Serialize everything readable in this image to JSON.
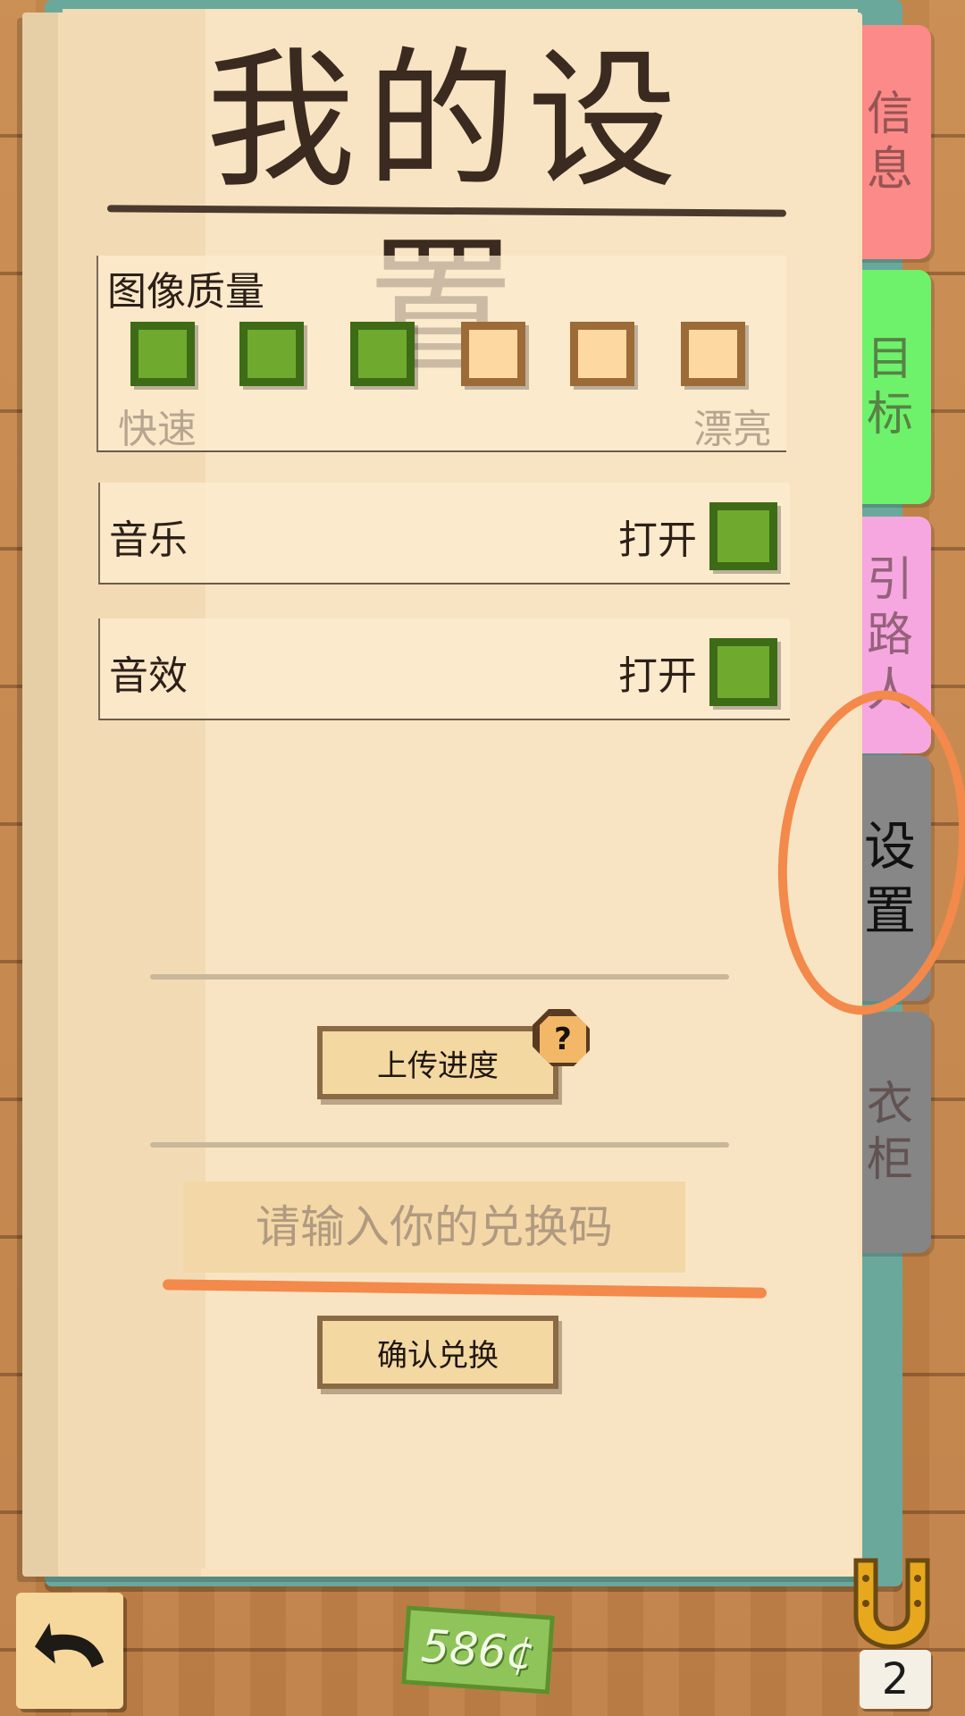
{
  "page": {
    "title": "我的设置"
  },
  "tabs": [
    {
      "label": [
        "信",
        "息"
      ]
    },
    {
      "label": [
        "目",
        "标"
      ]
    },
    {
      "label": [
        "引",
        "路",
        "人"
      ]
    },
    {
      "label": [
        "设",
        "置"
      ],
      "selected": true
    },
    {
      "label": [
        "衣",
        "柜"
      ]
    }
  ],
  "quality": {
    "label": "图像质量",
    "low_label": "快速",
    "high_label": "漂亮",
    "levels": 6,
    "selected_level": 3
  },
  "music": {
    "label": "音乐",
    "state_label": "打开"
  },
  "sfx": {
    "label": "音效",
    "state_label": "打开"
  },
  "upload": {
    "label": "上传进度",
    "help_glyph": "?"
  },
  "redeem": {
    "placeholder": "请输入你的兑换码",
    "button_label": "确认兑换"
  },
  "footer": {
    "money": "586¢",
    "horseshoe_count": "2"
  },
  "colors": {
    "accent_annotation": "#f3894a",
    "checkbox_on": "#6faa2e",
    "checkbox_off": "#fdd8a0"
  }
}
